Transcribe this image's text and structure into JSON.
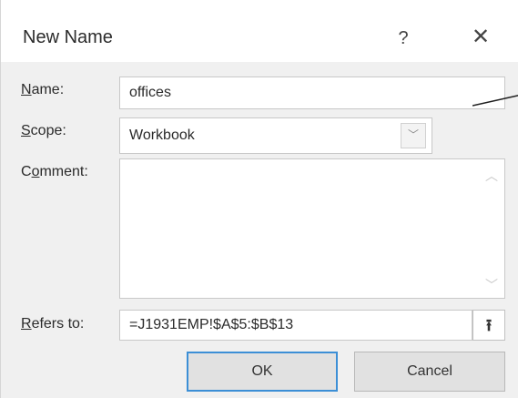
{
  "dialog": {
    "title": "New Name",
    "help_label": "?",
    "close_label": "✕"
  },
  "form": {
    "name_label": "Name:",
    "name_value": "offices",
    "scope_label": "Scope:",
    "scope_value": "Workbook",
    "comment_label": "Comment:",
    "comment_value": "",
    "refers_to_label": "Refers to:",
    "refers_to_value": "=J1931EMP!$A$5:$B$13"
  },
  "buttons": {
    "ok_label": "OK",
    "cancel_label": "Cancel",
    "collapse_glyph": "⭱"
  },
  "icons": {
    "scope_dropdown": "chevron-down-icon",
    "scroll_up": "chevron-up-icon",
    "scroll_down": "chevron-down-icon",
    "collapse": "collapse-dialog-icon",
    "close": "close-icon",
    "help": "help-icon"
  },
  "colors": {
    "ok_border": "#3c8fd6",
    "dialog_bg": "#f0f0f0"
  }
}
